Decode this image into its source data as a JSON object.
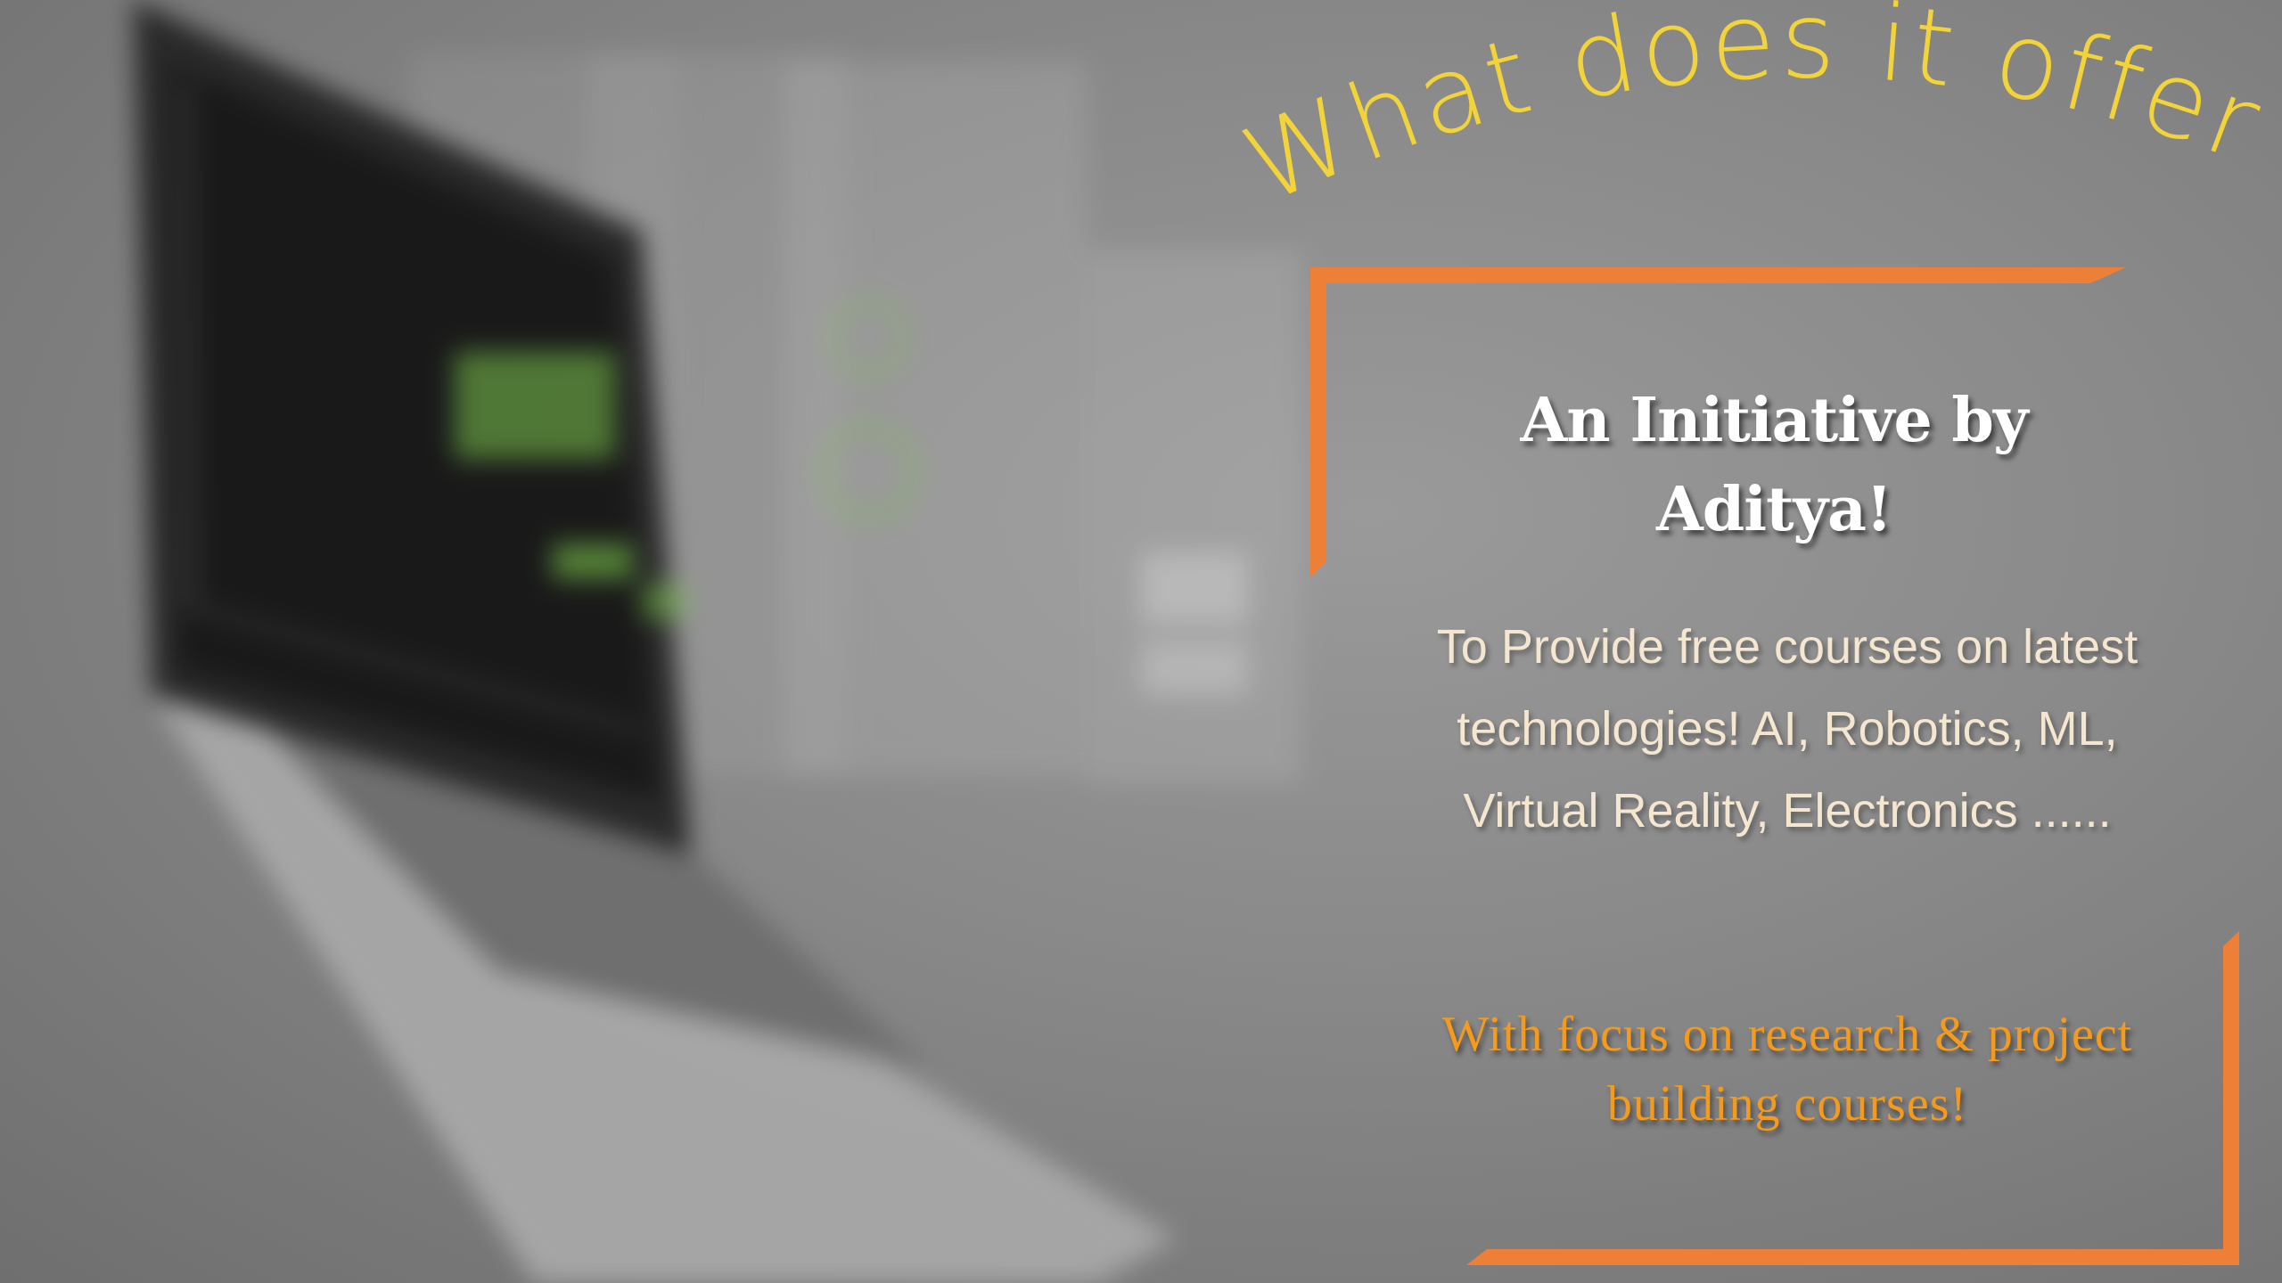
{
  "colors": {
    "title": "#f2d43a",
    "frame": "#ee7f36",
    "heading": "#ffffff",
    "description": "#f4e6cf",
    "focus": "#f49a1c"
  },
  "illustration": {
    "icon": "laptop-icon"
  },
  "title": "What does it offer?",
  "heading": {
    "line1": "An Initiative by",
    "line2": "Aditya!"
  },
  "description": "To Provide free courses on latest technologies! AI, Robotics, ML,  Virtual Reality, Electronics ......",
  "focus": "With  focus on research & project building courses!"
}
